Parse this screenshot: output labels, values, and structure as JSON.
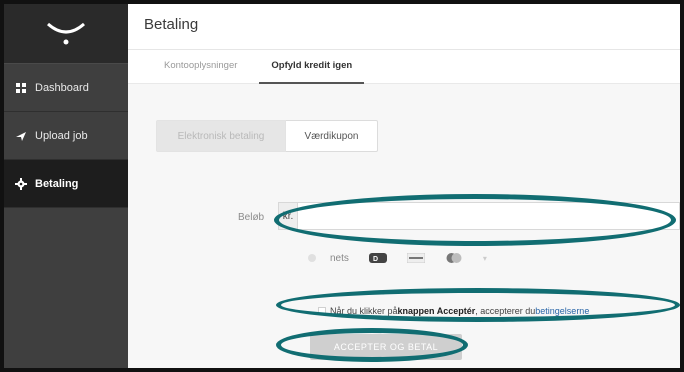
{
  "sidebar": {
    "items": [
      {
        "label": "Dashboard",
        "icon": "grid-icon"
      },
      {
        "label": "Upload job",
        "icon": "plane-icon"
      },
      {
        "label": "Betaling",
        "icon": "gear-icon",
        "active": true
      }
    ]
  },
  "header": {
    "title": "Betaling"
  },
  "tabs": [
    {
      "label": "Kontooplysninger",
      "active": false
    },
    {
      "label": "Opfyld kredit igen",
      "active": true
    }
  ],
  "payment_type": {
    "option_a": "Elektronisk betaling",
    "option_b": "Værdikupon"
  },
  "amount": {
    "label": "Beløb",
    "currency": "kr.",
    "value": ""
  },
  "payment_methods": {
    "nets_label": "nets",
    "cards": [
      "dankort",
      "visa",
      "mastercard"
    ]
  },
  "terms": {
    "prefix": "Når du klikker på ",
    "bold": "knappen Acceptér",
    "middle": ", accepterer du ",
    "link": "betingelserne"
  },
  "accept_button": "ACCEPTER OG BETAL",
  "colors": {
    "sidebar": "#3f3f3f",
    "sidebar_active": "#1d1d1d",
    "annotation": "#116d72",
    "link": "#2a66a8"
  }
}
